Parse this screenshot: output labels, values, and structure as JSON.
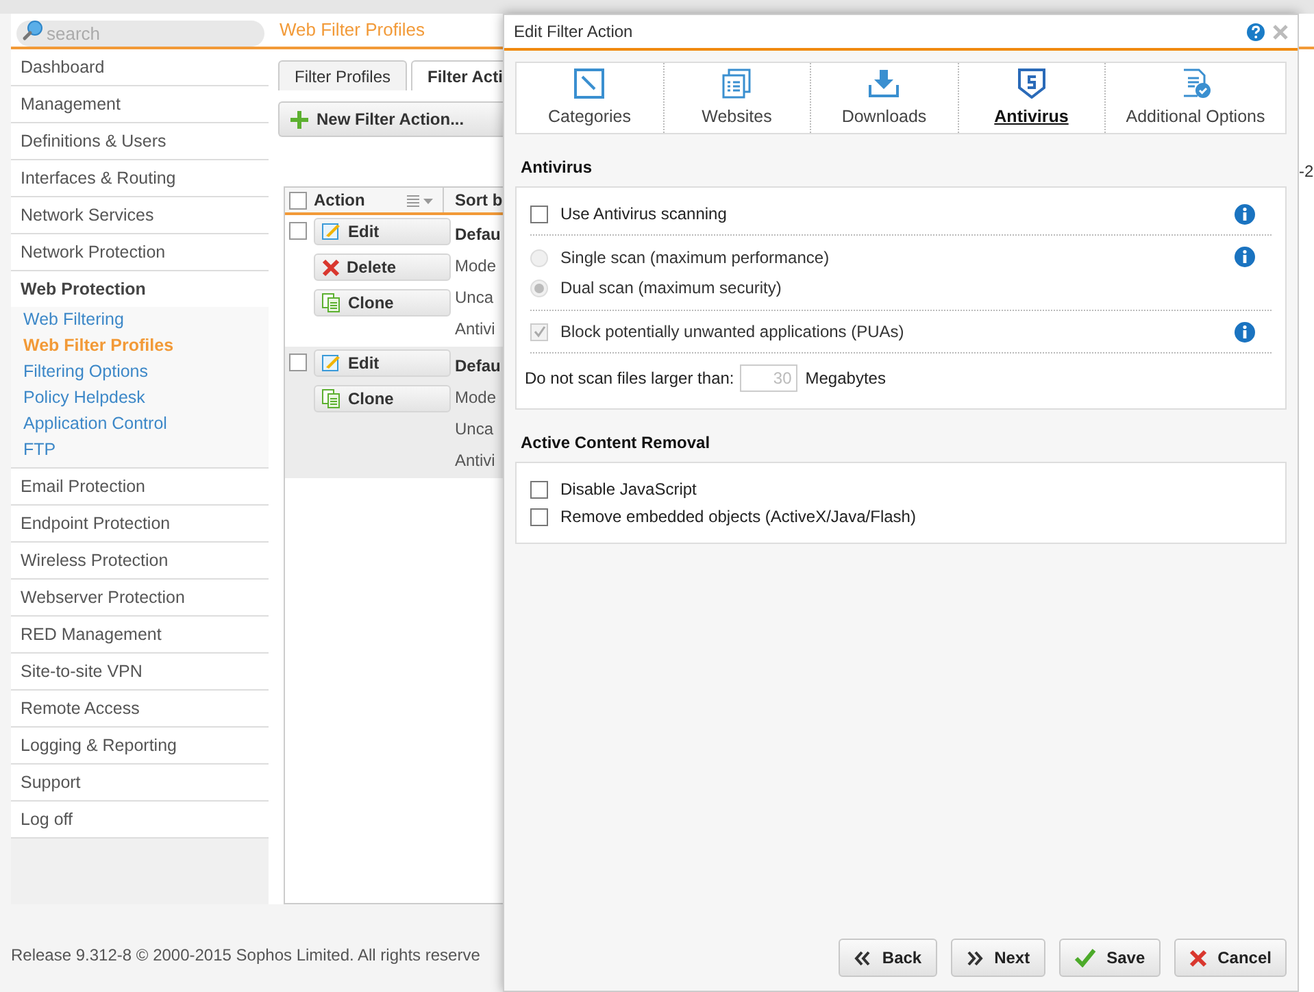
{
  "search": {
    "placeholder": "search"
  },
  "page_title": "Web Filter Profiles",
  "sidebar": {
    "items": [
      {
        "label": "Dashboard",
        "expanded": false
      },
      {
        "label": "Management",
        "expanded": false
      },
      {
        "label": "Definitions & Users",
        "expanded": false
      },
      {
        "label": "Interfaces & Routing",
        "expanded": false
      },
      {
        "label": "Network Services",
        "expanded": false
      },
      {
        "label": "Network Protection",
        "expanded": false
      },
      {
        "label": "Web Protection",
        "expanded": true,
        "children": [
          {
            "label": "Web Filtering",
            "selected": false
          },
          {
            "label": "Web Filter Profiles",
            "selected": true
          },
          {
            "label": "Filtering Options",
            "selected": false
          },
          {
            "label": "Policy Helpdesk",
            "selected": false
          },
          {
            "label": "Application Control",
            "selected": false
          },
          {
            "label": "FTP",
            "selected": false
          }
        ]
      },
      {
        "label": "Email Protection",
        "expanded": false
      },
      {
        "label": "Endpoint Protection",
        "expanded": false
      },
      {
        "label": "Wireless Protection",
        "expanded": false
      },
      {
        "label": "Webserver Protection",
        "expanded": false
      },
      {
        "label": "RED Management",
        "expanded": false
      },
      {
        "label": "Site-to-site VPN",
        "expanded": false
      },
      {
        "label": "Remote Access",
        "expanded": false
      },
      {
        "label": "Logging & Reporting",
        "expanded": false
      },
      {
        "label": "Support",
        "expanded": false
      },
      {
        "label": "Log off",
        "expanded": false
      }
    ]
  },
  "main": {
    "tabs": [
      {
        "label": "Filter Profiles",
        "selected": false
      },
      {
        "label": "Filter Acti",
        "selected": true
      }
    ],
    "new_button": "New Filter Action...",
    "table": {
      "all_checked": false,
      "columns": [
        "Action",
        "Sort b"
      ],
      "rows": [
        {
          "checked": false,
          "actions": [
            {
              "kind": "edit",
              "label": "Edit"
            },
            {
              "kind": "delete",
              "label": "Delete"
            },
            {
              "kind": "clone",
              "label": "Clone"
            }
          ],
          "lines": [
            "Defau",
            "Mode",
            "Unca",
            "Antivi"
          ]
        },
        {
          "checked": false,
          "actions": [
            {
              "kind": "edit",
              "label": "Edit"
            },
            {
              "kind": "clone",
              "label": "Clone"
            }
          ],
          "lines": [
            "Defau",
            "Mode",
            "Unca",
            "Antivi"
          ]
        }
      ]
    },
    "right_fragment": "-2"
  },
  "footer": "Release 9.312-8  © 2000-2015 Sophos Limited. All rights reserve",
  "dialog": {
    "title": "Edit Filter Action",
    "tabs": [
      {
        "kind": "categories",
        "label": "Categories",
        "selected": false
      },
      {
        "kind": "websites",
        "label": "Websites",
        "selected": false
      },
      {
        "kind": "downloads",
        "label": "Downloads",
        "selected": false
      },
      {
        "kind": "antivirus",
        "label": "Antivirus",
        "selected": true
      },
      {
        "kind": "options",
        "label": "Additional Options",
        "selected": false
      }
    ],
    "sections": [
      {
        "title": "Antivirus",
        "groups": [
          {
            "info": true,
            "items": [
              {
                "kind": "checkbox",
                "label": "Use Antivirus scanning",
                "checked": false,
                "disabled": false
              }
            ]
          },
          {
            "info": true,
            "items": [
              {
                "kind": "radio",
                "label": "Single scan (maximum performance)",
                "selected": false,
                "disabled": true
              },
              {
                "kind": "radio",
                "label": "Dual scan (maximum security)",
                "selected": true,
                "disabled": true
              }
            ]
          },
          {
            "info": true,
            "items": [
              {
                "kind": "checkbox",
                "label": "Block potentially unwanted applications (PUAs)",
                "checked": true,
                "disabled": true
              }
            ]
          },
          {
            "info": false,
            "items": [
              {
                "kind": "number",
                "label": "Do not scan files larger than:",
                "value": "30",
                "unit": "Megabytes",
                "disabled": true
              }
            ]
          }
        ]
      },
      {
        "title": "Active Content Removal",
        "groups": [
          {
            "info": false,
            "items": [
              {
                "kind": "checkbox",
                "label": "Disable JavaScript",
                "checked": false,
                "disabled": false
              },
              {
                "kind": "checkbox",
                "label": "Remove embedded objects (ActiveX/Java/Flash)",
                "checked": false,
                "disabled": false
              }
            ]
          }
        ]
      }
    ],
    "buttons": [
      {
        "kind": "back",
        "label": "Back"
      },
      {
        "kind": "next",
        "label": "Next"
      },
      {
        "kind": "save",
        "label": "Save"
      },
      {
        "kind": "cancel",
        "label": "Cancel"
      }
    ]
  }
}
